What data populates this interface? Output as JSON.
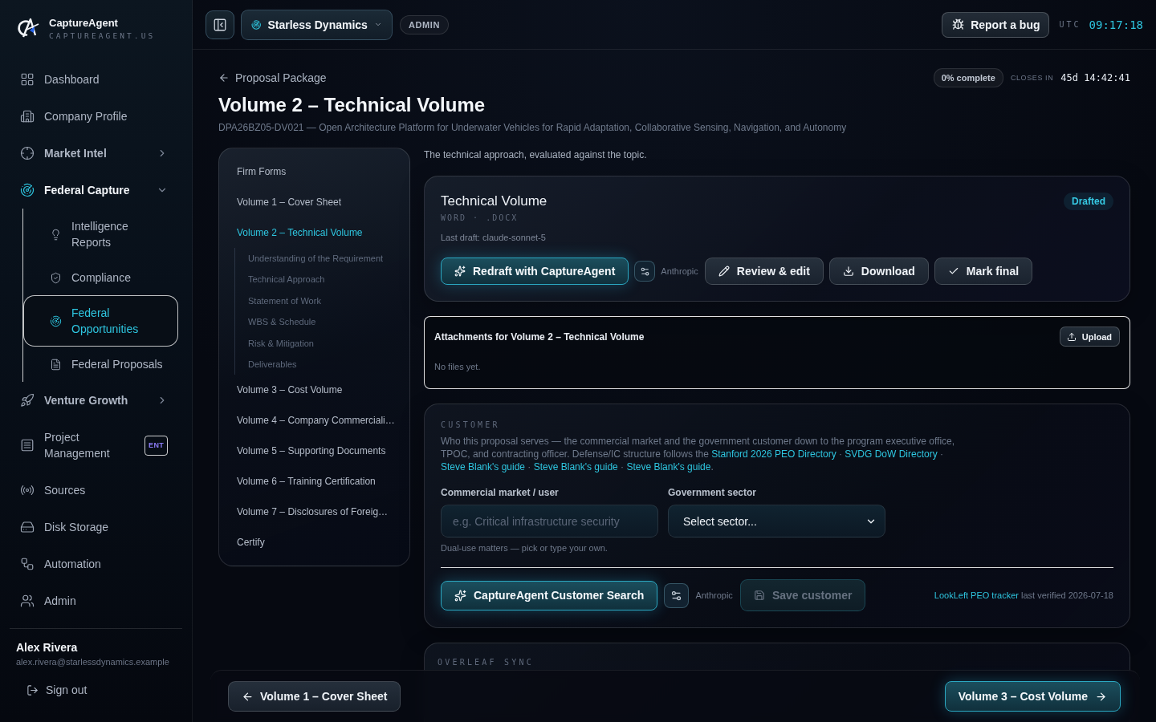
{
  "sidebar": {
    "brand": {
      "name": "CaptureAgent",
      "domain": "CAPTUREAGENT.US"
    },
    "items": [
      {
        "label": "Dashboard",
        "kind": "link",
        "selected": false
      },
      {
        "label": "Company Profile",
        "kind": "link",
        "selected": false
      },
      {
        "label": "Market Intel",
        "kind": "group",
        "expanded": false,
        "selected": false
      },
      {
        "label": "Federal Capture",
        "kind": "group",
        "expanded": true,
        "selected": false,
        "children": [
          {
            "label": "Intelligence Reports",
            "selected": false
          },
          {
            "label": "Compliance",
            "selected": false
          },
          {
            "label": "Federal Opportunities",
            "selected": true
          },
          {
            "label": "Federal Proposals",
            "selected": false
          }
        ]
      },
      {
        "label": "Venture Growth",
        "kind": "group",
        "expanded": false,
        "selected": false
      },
      {
        "label": "Project Management",
        "kind": "link",
        "selected": false,
        "badge": "ENT"
      },
      {
        "label": "Sources",
        "kind": "link",
        "selected": false
      },
      {
        "label": "Disk Storage",
        "kind": "link",
        "selected": false
      },
      {
        "label": "Automation",
        "kind": "link",
        "selected": false
      },
      {
        "label": "Admin",
        "kind": "link",
        "selected": false
      }
    ],
    "user": {
      "name": "Alex Rivera",
      "email": "alex.rivera@starlessdynamics.example",
      "sign_out": "Sign out"
    }
  },
  "header": {
    "org": "Starless Dynamics",
    "role": "ADMIN",
    "report_bug": "Report a bug",
    "clock_zone": "UTC",
    "clock_time": "09:17:18"
  },
  "page": {
    "back": "Proposal Package",
    "title": "Volume 2 – Technical Volume",
    "subtitle": "DPA26BZ05-DV021 — Open Architecture Platform for Underwater Vehicles for Rapid Adaptation, Collaborative Sensing, Navigation, and Autonomy",
    "progress": "0% complete",
    "closes_label": "CLOSES IN",
    "closes_in": "45d 14:42:41"
  },
  "proposal_nav": {
    "items": [
      {
        "label": "Firm Forms",
        "selected": false
      },
      {
        "label": "Volume 1 – Cover Sheet",
        "selected": false
      },
      {
        "label": "Volume 2 – Technical Volume",
        "selected": true,
        "children": [
          {
            "label": "Understanding of the Requirement"
          },
          {
            "label": "Technical Approach"
          },
          {
            "label": "Statement of Work"
          },
          {
            "label": "WBS & Schedule"
          },
          {
            "label": "Risk & Mitigation"
          },
          {
            "label": "Deliverables"
          }
        ]
      },
      {
        "label": "Volume 3 – Cost Volume",
        "selected": false
      },
      {
        "label": "Volume 4 – Company Commerciali…",
        "selected": false
      },
      {
        "label": "Volume 5 – Supporting Documents",
        "selected": false
      },
      {
        "label": "Volume 6 – Training Certification",
        "selected": false
      },
      {
        "label": "Volume 7 – Disclosures of Foreig…",
        "selected": false
      },
      {
        "label": "Certify",
        "selected": false
      }
    ]
  },
  "volume": {
    "intro": "The technical approach, evaluated against the topic.",
    "document": {
      "title": "Technical Volume",
      "format": "WORD · .DOCX",
      "last_draft": "Last draft: claude-sonnet-5",
      "status": "Drafted",
      "redraft": {
        "label": "Redraft with CaptureAgent",
        "provider": "Anthropic"
      },
      "actions": [
        {
          "label": "Review & edit"
        },
        {
          "label": "Download"
        },
        {
          "label": "Mark final"
        }
      ]
    },
    "attachments": {
      "title": "Attachments for Volume 2 – Technical Volume",
      "upload": "Upload",
      "empty": "No files yet."
    },
    "customer": {
      "heading": "CUSTOMER",
      "description": [
        {
          "kind": "text",
          "text": "Who this proposal serves — the commercial market and the government customer down to the program executive office, TPOC, and contracting officer. Defense/IC structure follows the "
        },
        {
          "kind": "link",
          "text": "Stanford 2026 PEO Directory"
        },
        {
          "kind": "text",
          "text": " · "
        },
        {
          "kind": "link",
          "text": "SVDG DoW Directory"
        },
        {
          "kind": "text",
          "text": " · "
        },
        {
          "kind": "link",
          "text": "Steve Blank's guide"
        },
        {
          "kind": "text",
          "text": " · "
        },
        {
          "kind": "link",
          "text": "Steve Blank's guide"
        },
        {
          "kind": "text",
          "text": " · "
        },
        {
          "kind": "link",
          "text": "Steve Blank's guide"
        },
        {
          "kind": "text",
          "text": "."
        }
      ],
      "fields": [
        {
          "label": "Commercial market / user",
          "kind": "text",
          "placeholder": "e.g. Critical infrastructure security"
        },
        {
          "label": "Government sector",
          "kind": "select",
          "value": "Select sector..."
        }
      ],
      "hint": "Dual-use matters — pick or type your own.",
      "search": {
        "label": "CaptureAgent Customer Search",
        "provider": "Anthropic"
      },
      "save": {
        "label": "Save customer",
        "disabled": true
      },
      "source": {
        "link": "LookLeft PEO tracker",
        "note": "last verified 2026-07-18"
      }
    },
    "overleaf": {
      "heading": "OVERLEAF SYNC"
    }
  },
  "footer_nav": {
    "previous": "Volume 1 – Cover Sheet",
    "next": "Volume 3 – Cost Volume"
  }
}
